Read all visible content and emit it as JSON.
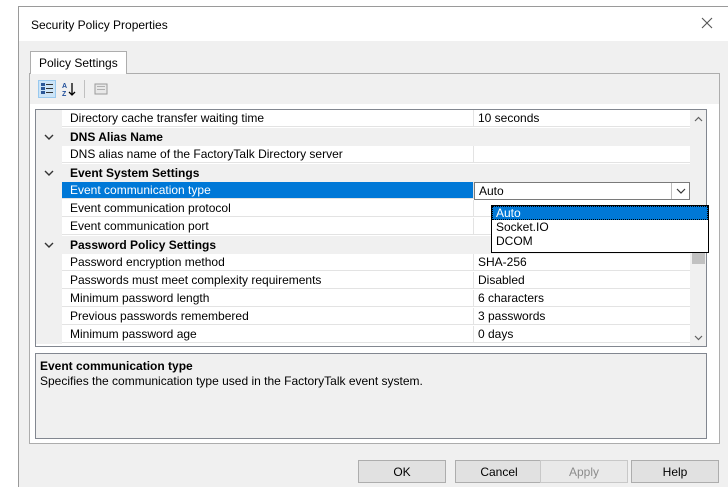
{
  "window": {
    "title": "Security Policy Properties",
    "close_icon": "close-icon"
  },
  "tab": {
    "label": "Policy Settings"
  },
  "toolbar": {
    "icons": [
      "categorized-view-icon",
      "alphabetical-sort-icon",
      "property-pages-icon"
    ]
  },
  "grid": {
    "rows": [
      {
        "type": "prop",
        "name": "Directory cache transfer waiting time",
        "value": "10 seconds"
      },
      {
        "type": "category",
        "name": "DNS Alias Name"
      },
      {
        "type": "prop",
        "name": "DNS alias name of the FactoryTalk Directory server",
        "value": ""
      },
      {
        "type": "category",
        "name": "Event System Settings"
      },
      {
        "type": "prop",
        "name": "Event communication type",
        "value": "Auto",
        "selected": true
      },
      {
        "type": "prop",
        "name": "Event communication protocol",
        "value": ""
      },
      {
        "type": "prop",
        "name": "Event communication port",
        "value": ""
      },
      {
        "type": "category",
        "name": "Password Policy Settings"
      },
      {
        "type": "prop",
        "name": "Password encryption method",
        "value": "SHA-256"
      },
      {
        "type": "prop",
        "name": "Passwords must meet complexity requirements",
        "value": "Disabled"
      },
      {
        "type": "prop",
        "name": "Minimum password length",
        "value": "6 characters"
      },
      {
        "type": "prop",
        "name": "Previous passwords remembered",
        "value": "3 passwords"
      },
      {
        "type": "prop",
        "name": "Minimum password age",
        "value": "0 days"
      }
    ]
  },
  "dropdown": {
    "options": [
      "Auto",
      "Socket.IO",
      "DCOM"
    ],
    "selected": "Auto"
  },
  "description": {
    "title": "Event communication type",
    "text": "Specifies the communication type used in the FactoryTalk event system."
  },
  "buttons": {
    "ok": "OK",
    "cancel": "Cancel",
    "apply": "Apply",
    "help": "Help"
  },
  "colors": {
    "selection": "#0078d7",
    "dialog_bg": "#f0f0f0",
    "category_bg": "#f0f0f0"
  }
}
